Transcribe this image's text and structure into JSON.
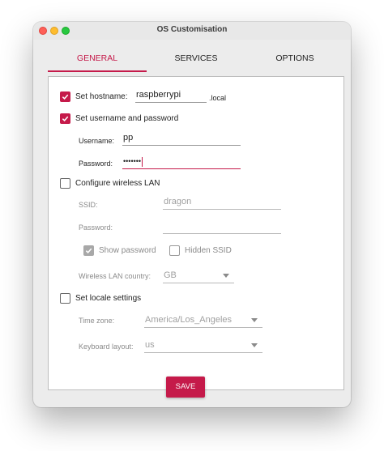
{
  "window": {
    "title": "OS Customisation"
  },
  "tabs": [
    {
      "label": "GENERAL",
      "active": true
    },
    {
      "label": "SERVICES",
      "active": false
    },
    {
      "label": "OPTIONS",
      "active": false
    }
  ],
  "hostname": {
    "checkbox_label": "Set hostname:",
    "checked": true,
    "value": "raspberrypi",
    "suffix": ".local"
  },
  "user": {
    "checkbox_label": "Set username and password",
    "checked": true,
    "username_label": "Username:",
    "username_value": "pp",
    "password_label": "Password:",
    "password_value": "•••••••"
  },
  "wireless": {
    "checkbox_label": "Configure wireless LAN",
    "checked": false,
    "ssid_label": "SSID:",
    "ssid_value": "dragon",
    "password_label": "Password:",
    "password_value": "",
    "show_password_label": "Show password",
    "show_password_checked": true,
    "hidden_ssid_label": "Hidden SSID",
    "hidden_ssid_checked": false,
    "country_label": "Wireless LAN country:",
    "country_value": "GB"
  },
  "locale": {
    "checkbox_label": "Set locale settings",
    "checked": false,
    "timezone_label": "Time zone:",
    "timezone_value": "America/Los_Angeles",
    "keyboard_label": "Keyboard layout:",
    "keyboard_value": "us"
  },
  "actions": {
    "save_label": "SAVE"
  },
  "colors": {
    "accent": "#c51a4a"
  }
}
